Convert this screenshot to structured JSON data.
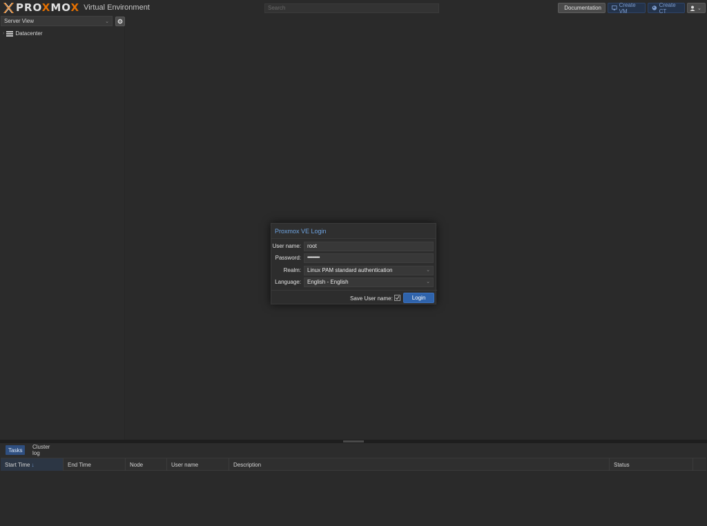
{
  "header": {
    "logo_prefix": "PRO",
    "logo_x": "X",
    "logo_mid": "MO",
    "logo_x2": "X",
    "subtitle": "Virtual Environment",
    "search_placeholder": "Search",
    "buttons": {
      "documentation": "Documentation",
      "create_vm": "Create VM",
      "create_ct": "Create CT"
    }
  },
  "sidebar": {
    "view_select": "Server View",
    "tree": [
      {
        "label": "Datacenter"
      }
    ]
  },
  "login": {
    "title": "Proxmox VE Login",
    "fields": {
      "username_label": "User name:",
      "username_value": "root",
      "password_label": "Password:",
      "password_value": "••••••••••••",
      "realm_label": "Realm:",
      "realm_value": "Linux PAM standard authentication",
      "language_label": "Language:",
      "language_value": "English - English"
    },
    "save_username_label": "Save User name:",
    "save_username_checked": true,
    "login_button": "Login"
  },
  "bottom": {
    "tabs": [
      "Tasks",
      "Cluster log"
    ],
    "columns": [
      "Start Time",
      "End Time",
      "Node",
      "User name",
      "Description",
      "Status"
    ],
    "sort_indicator": "↓"
  },
  "colors": {
    "accent_orange": "#e57000",
    "accent_blue": "#2f63ab",
    "title_blue": "#6ea3e0",
    "background": "#2a2a2a"
  }
}
